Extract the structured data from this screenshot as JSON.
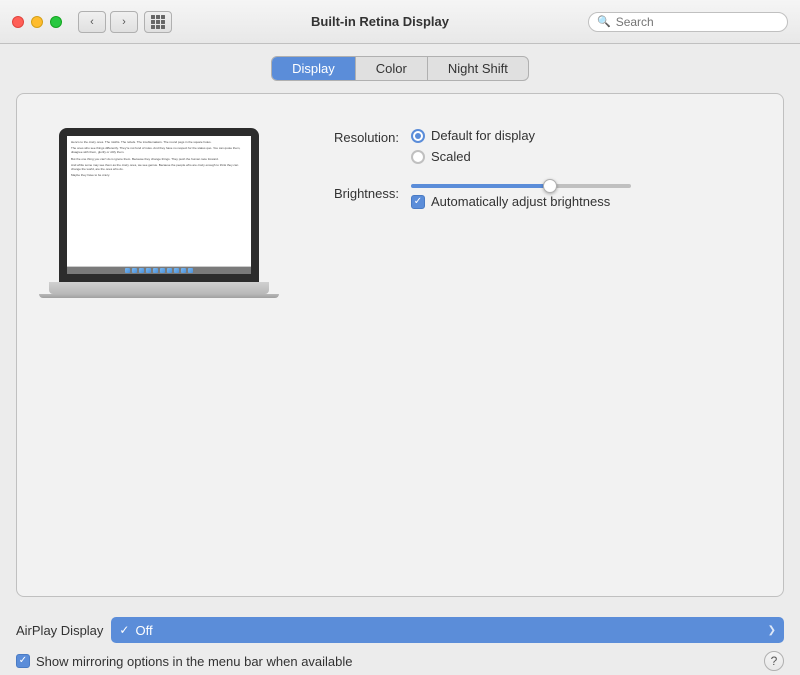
{
  "titlebar": {
    "title": "Built-in Retina Display",
    "search_placeholder": "Search"
  },
  "tabs": [
    {
      "id": "display",
      "label": "Display",
      "active": true
    },
    {
      "id": "color",
      "label": "Color",
      "active": false
    },
    {
      "id": "nightshift",
      "label": "Night Shift",
      "active": false
    }
  ],
  "settings": {
    "resolution_label": "Resolution:",
    "resolution_options": [
      {
        "id": "default",
        "label": "Default for display",
        "selected": true
      },
      {
        "id": "scaled",
        "label": "Scaled",
        "selected": false
      }
    ],
    "brightness_label": "Brightness:",
    "auto_brightness_label": "Automatically adjust brightness",
    "auto_brightness_checked": true
  },
  "bottom": {
    "airplay_label": "AirPlay Display",
    "airplay_value": "Off",
    "mirror_label": "Show mirroring options in the menu bar when available",
    "mirror_checked": true,
    "help": "?"
  },
  "laptop_text": {
    "line1": "Here's to the crazy ones. The misfits. The rebels. The troublemakers. The round pegs in the square holes.",
    "line2": "The ones who see things differently. They're not fond of rules. And they have no respect for the status quo. You can quote them, disagree with them, glorify or vilify them.",
    "line3": "But the one thing you can't do is ignore them. Because they change things. They push the human race forward.",
    "line4": "And while some may see them as the crazy ones, we see genius. Because the people who are crazy enough to think they can change the world, are the ones who do.",
    "line5": "Maybe they have to be crazy."
  }
}
